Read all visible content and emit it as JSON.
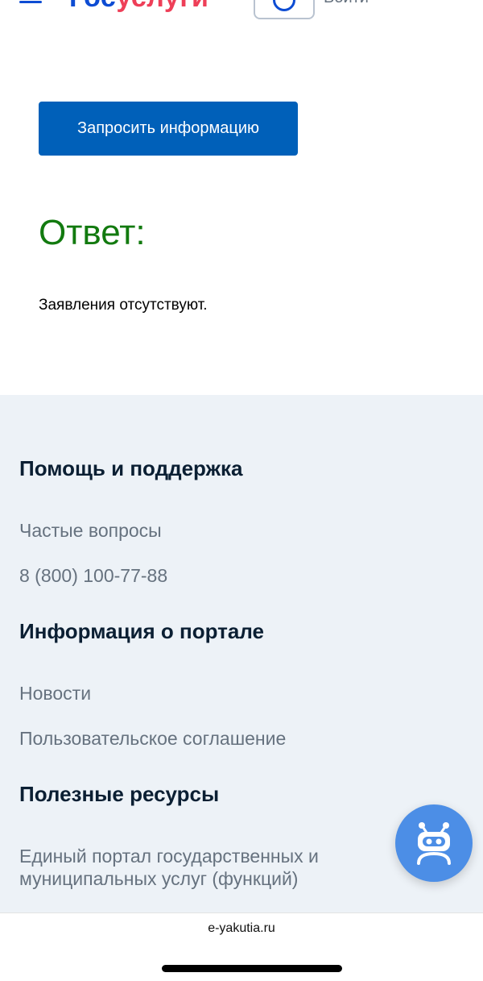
{
  "header": {
    "logo_part1": "Гос",
    "logo_part2": "услуги",
    "login_label": "Войти"
  },
  "main": {
    "request_button_label": "Запросить информацию",
    "answer_title": "Ответ:",
    "answer_text": "Заявления отсутствуют."
  },
  "footer": {
    "sections": [
      {
        "heading": "Помощь и поддержка",
        "links": [
          "Частые вопросы",
          "8 (800) 100-77-88"
        ]
      },
      {
        "heading": "Информация о портале",
        "links": [
          "Новости",
          "Пользовательское соглашение"
        ]
      },
      {
        "heading": "Полезные ресурсы",
        "links": [
          "Единый портал государственных и муниципальных услуг (функций)"
        ]
      }
    ]
  },
  "browser": {
    "domain": "e-yakutia.ru"
  },
  "colors": {
    "brand_blue": "#0d4cd3",
    "button_blue": "#0060b9",
    "answer_green": "#127a0f",
    "footer_bg": "#edf2f7",
    "bot_blue": "#4c8ee6"
  }
}
